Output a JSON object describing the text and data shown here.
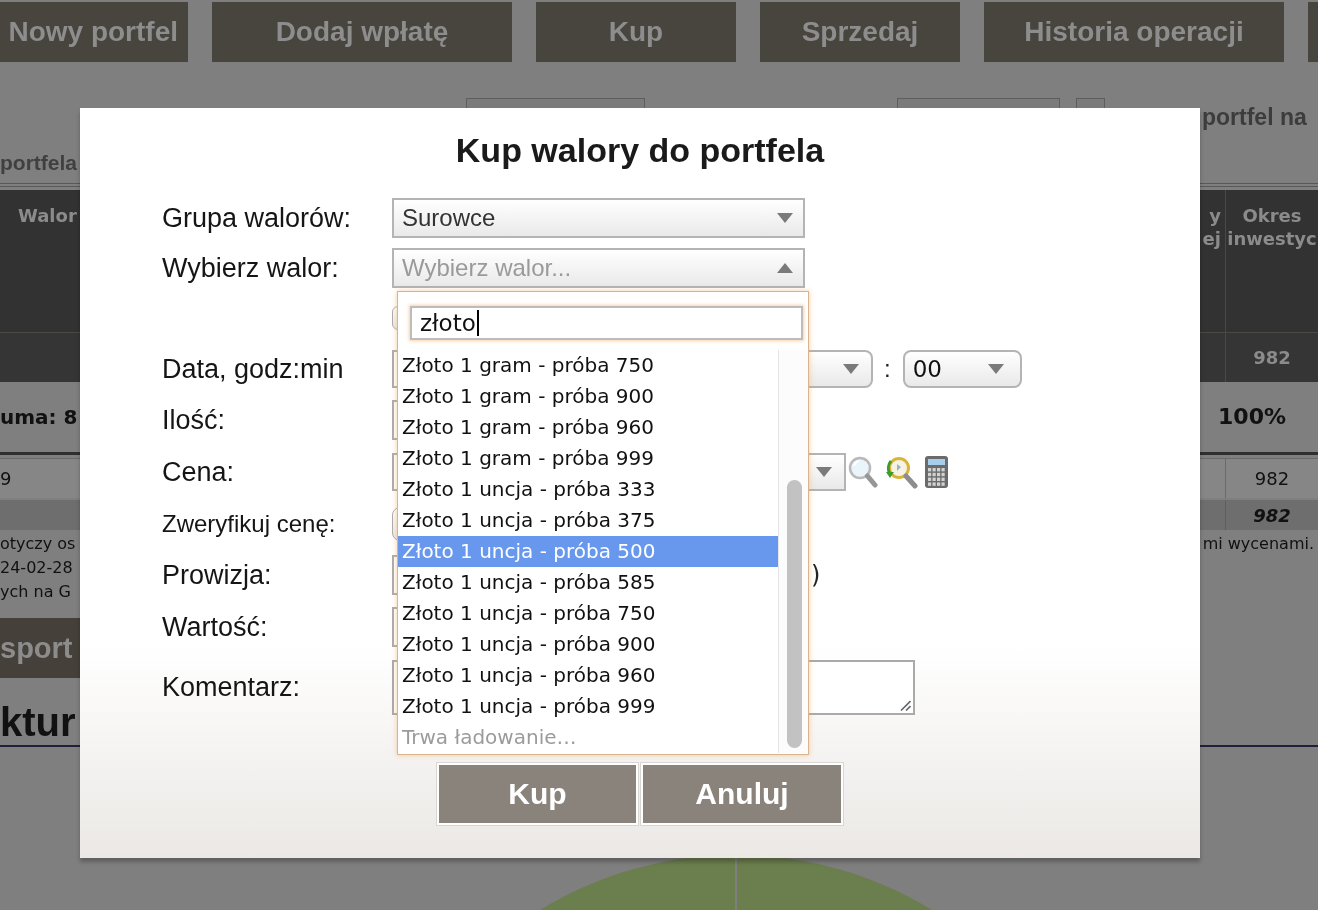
{
  "nav": {
    "buttons": [
      {
        "label": "Nowy portfel"
      },
      {
        "label": "Dodaj wpłatę"
      },
      {
        "label": "Kup"
      },
      {
        "label": "Sprzedaj"
      },
      {
        "label": "Historia operacji"
      }
    ]
  },
  "toolbar": {
    "right_label": "portfel na",
    "left_label": "portfela"
  },
  "table": {
    "columns": [
      "Walor",
      "y ej",
      "Okres inwestyc"
    ],
    "rows": [
      {
        "kind": "dark",
        "last": "982"
      },
      {
        "kind": "summary",
        "first": "uma: 8",
        "last": "100%"
      },
      {
        "kind": "normal",
        "first": "9",
        "last": "982"
      },
      {
        "kind": "total",
        "last": "982"
      }
    ]
  },
  "notes": {
    "left": [
      "otyczy os",
      "24-02-28",
      "ych na G"
    ],
    "right": "mi wycenami."
  },
  "action_button": {
    "label": "sport"
  },
  "section_heading": "ktur",
  "dialog": {
    "title": "Kup walory do portfela",
    "fields": [
      {
        "kind": "select",
        "label": "Grupa walorów:",
        "value": "Surowce"
      },
      {
        "kind": "combo",
        "label": "Wybierz walor:",
        "placeholder": "Wybierz walor...",
        "expanded": true
      },
      {
        "kind": "blank"
      },
      {
        "kind": "datetime",
        "label": "Data, godz:min",
        "separator": ":",
        "minute": "00"
      },
      {
        "kind": "input",
        "label": "Ilość:"
      },
      {
        "kind": "price",
        "label": "Cena:"
      },
      {
        "kind": "verify",
        "label": "Zweryfikuj cenę:"
      },
      {
        "kind": "commission",
        "label": "Prowizja:",
        "suffix": ")"
      },
      {
        "kind": "input",
        "label": "Wartość:"
      },
      {
        "kind": "textarea",
        "label": "Komentarz:"
      }
    ],
    "dropdown": {
      "search": "złoto",
      "options": [
        {
          "label": "Złoto 1 gram - próba 750",
          "selected": false
        },
        {
          "label": "Złoto 1 gram - próba 900",
          "selected": false
        },
        {
          "label": "Złoto 1 gram - próba 960",
          "selected": false
        },
        {
          "label": "Złoto 1 gram - próba 999",
          "selected": false
        },
        {
          "label": "Złoto 1 uncja - próba 333",
          "selected": false
        },
        {
          "label": "Złoto 1 uncja - próba 375",
          "selected": false
        },
        {
          "label": "Złoto 1 uncja - próba 500",
          "selected": true
        },
        {
          "label": "Złoto 1 uncja - próba 585",
          "selected": false
        },
        {
          "label": "Złoto 1 uncja - próba 750",
          "selected": false
        },
        {
          "label": "Złoto 1 uncja - próba 900",
          "selected": false
        },
        {
          "label": "Złoto 1 uncja - próba 960",
          "selected": false
        },
        {
          "label": "Złoto 1 uncja - próba 999",
          "selected": false
        }
      ],
      "status": "Trwa ładowanie…"
    },
    "buttons": [
      {
        "label": "Kup"
      },
      {
        "label": "Anuluj"
      }
    ]
  }
}
